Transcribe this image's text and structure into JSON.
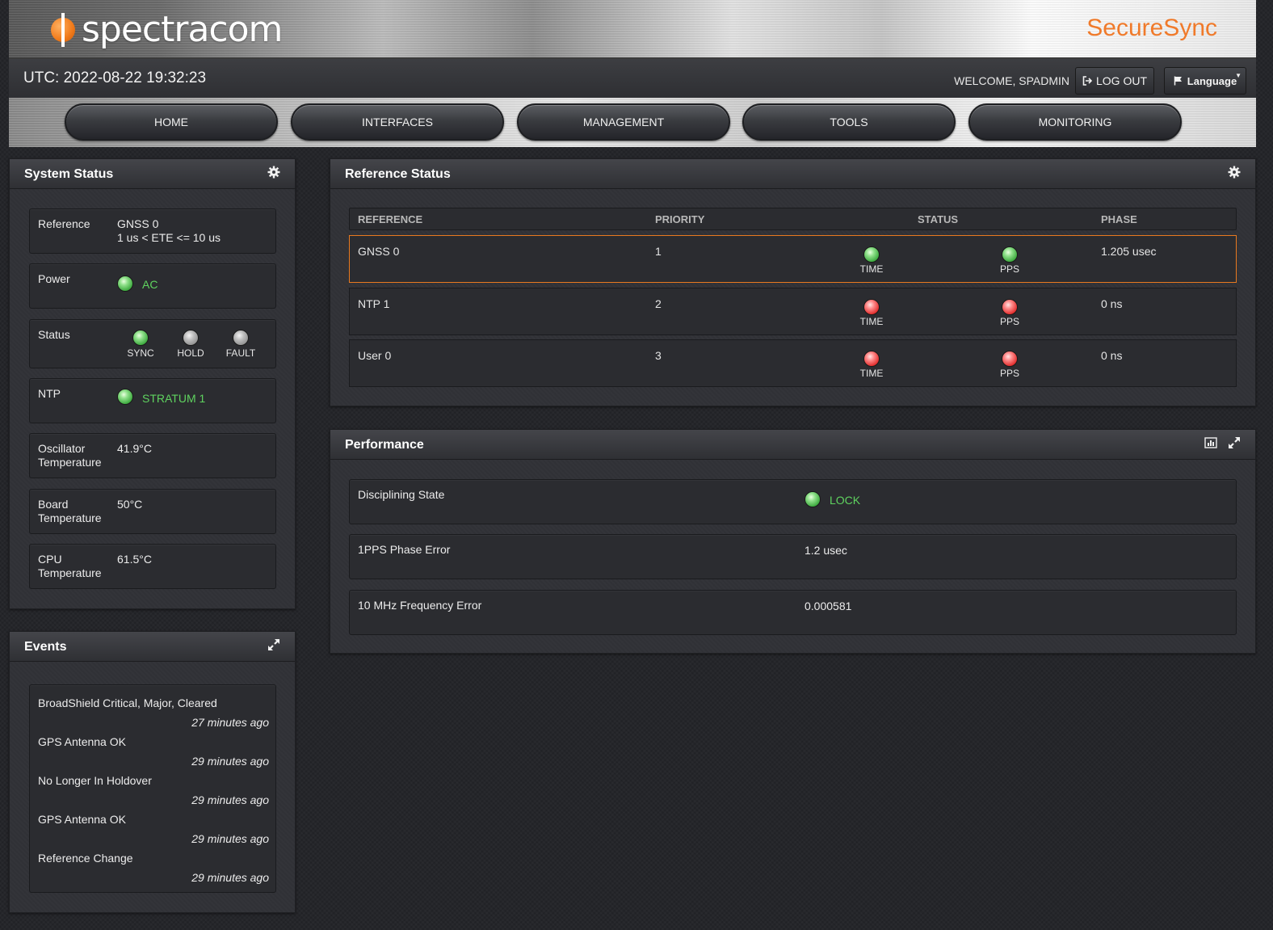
{
  "header": {
    "logo_text": "spectracom",
    "product_name": "SecureSync"
  },
  "topbar": {
    "utc": "UTC: 2022-08-22 19:32:23",
    "welcome": "WELCOME, SPADMIN",
    "logout_label": "LOG OUT",
    "language_label": "Language"
  },
  "nav": {
    "items": [
      {
        "label": "HOME"
      },
      {
        "label": "INTERFACES"
      },
      {
        "label": "MANAGEMENT"
      },
      {
        "label": "TOOLS"
      },
      {
        "label": "MONITORING"
      }
    ]
  },
  "system_status": {
    "title": "System Status",
    "reference_label": "Reference",
    "reference_value": "GNSS 0",
    "reference_detail": "1 us < ETE <= 10 us",
    "power_label": "Power",
    "power_value": "AC",
    "status_label": "Status",
    "status_indicators": [
      {
        "label": "SYNC",
        "state": "green"
      },
      {
        "label": "HOLD",
        "state": "grey"
      },
      {
        "label": "FAULT",
        "state": "grey"
      }
    ],
    "ntp_label": "NTP",
    "ntp_value": "STRATUM 1",
    "osc_label_1": "Oscillator",
    "osc_label_2": "Temperature",
    "osc_value": "41.9°C",
    "board_label_1": "Board",
    "board_label_2": "Temperature",
    "board_value": "50°C",
    "cpu_label_1": "CPU",
    "cpu_label_2": "Temperature",
    "cpu_value": "61.5°C"
  },
  "events": {
    "title": "Events",
    "items": [
      {
        "name": "BroadShield Critical, Major, Cleared",
        "time": "27 minutes ago"
      },
      {
        "name": "GPS Antenna OK",
        "time": "29 minutes ago"
      },
      {
        "name": "No Longer In Holdover",
        "time": "29 minutes ago"
      },
      {
        "name": "GPS Antenna OK",
        "time": "29 minutes ago"
      },
      {
        "name": "Reference Change",
        "time": "29 minutes ago"
      }
    ]
  },
  "reference_status": {
    "title": "Reference Status",
    "columns": {
      "reference": "REFERENCE",
      "priority": "PRIORITY",
      "status": "STATUS",
      "phase": "PHASE"
    },
    "time_label": "TIME",
    "pps_label": "PPS",
    "rows": [
      {
        "reference": "GNSS 0",
        "priority": "1",
        "time_state": "green",
        "pps_state": "green",
        "phase": "1.205 usec"
      },
      {
        "reference": "NTP 1",
        "priority": "2",
        "time_state": "red",
        "pps_state": "red",
        "phase": "0 ns"
      },
      {
        "reference": "User 0",
        "priority": "3",
        "time_state": "red",
        "pps_state": "red",
        "phase": "0 ns"
      }
    ]
  },
  "performance": {
    "title": "Performance",
    "disciplining_label": "Disciplining State",
    "disciplining_value": "LOCK",
    "pps_error_label": "1PPS Phase Error",
    "pps_error_value": "1.2 usec",
    "freq_error_label": "10 MHz Frequency Error",
    "freq_error_value": "0.000581"
  },
  "colors": {
    "accent": "#f07a2a",
    "ok_green": "#5fd35f",
    "fault_red": "#e02a2a",
    "active_row_border": "#e8791f"
  },
  "icons": [
    "gear-icon",
    "expand-icon",
    "chart-icon",
    "logout-icon",
    "flag-icon",
    "led-indicator"
  ]
}
